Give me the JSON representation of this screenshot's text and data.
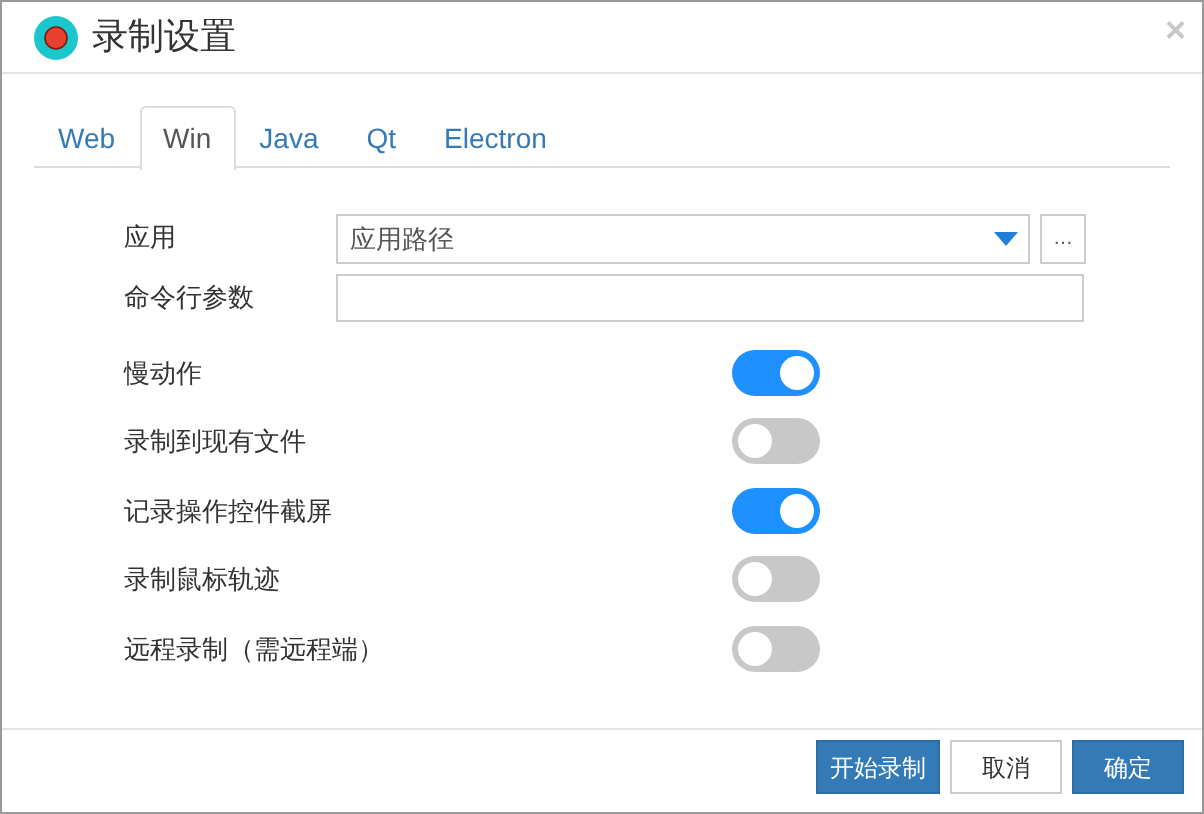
{
  "window": {
    "title": "录制设置",
    "close": "×"
  },
  "tabs": [
    {
      "label": "Web",
      "selected": false
    },
    {
      "label": "Win",
      "selected": true
    },
    {
      "label": "Java",
      "selected": false
    },
    {
      "label": "Qt",
      "selected": false
    },
    {
      "label": "Electron",
      "selected": false
    }
  ],
  "fields": [
    {
      "kind": "dropdown",
      "label": "应用",
      "placeholder": "应用路径",
      "browse": "…"
    },
    {
      "kind": "text",
      "label": "命令行参数"
    }
  ],
  "switches": [
    {
      "label": "慢动作",
      "on": true
    },
    {
      "label": "录制到现有文件",
      "on": false
    },
    {
      "label": "记录操作控件截屏",
      "on": true
    },
    {
      "label": "录制鼠标轨迹",
      "on": false
    },
    {
      "label": "远程录制（需远程端）",
      "on": false
    }
  ],
  "buttons": [
    {
      "label": "开始录制",
      "kind": "primary"
    },
    {
      "label": "取消",
      "kind": "secondary"
    },
    {
      "label": "确定",
      "kind": "primary"
    }
  ]
}
